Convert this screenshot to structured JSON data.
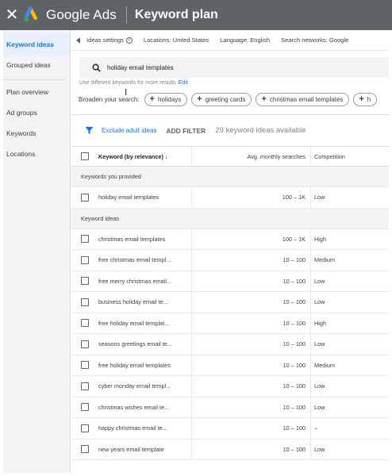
{
  "header": {
    "close_icon": "close-icon",
    "brand": "Google Ads",
    "title": "Keyword plan"
  },
  "sidebar": {
    "items": [
      {
        "label": "Keyword ideas",
        "active": true
      },
      {
        "label": "Grouped ideas"
      },
      {
        "label": "Plan overview"
      },
      {
        "label": "Ad groups"
      },
      {
        "label": "Keywords"
      },
      {
        "label": "Locations"
      }
    ]
  },
  "settings": {
    "ideas_settings": "Ideas settings",
    "locations": "Locations: United States",
    "language": "Language: English",
    "networks": "Search networks: Google"
  },
  "search": {
    "value": "holiday email templates",
    "hint": "Use different keywords for more results",
    "edit": "Edit"
  },
  "broaden": {
    "label": "Broaden your search:",
    "chips": [
      "holidays",
      "greeting cards",
      "christmas email templates",
      "h"
    ]
  },
  "filter": {
    "exclude": "Exclude adult ideas",
    "add_filter": "ADD FILTER",
    "available": "29 keyword ideas available"
  },
  "table": {
    "headers": {
      "keyword": "Keyword (by relevance)",
      "avg": "Avg. monthly searches",
      "competition": "Competition"
    },
    "group_provided": "Keywords you provided",
    "provided": [
      {
        "keyword": "holiday email templates",
        "avg": "100 – 1K",
        "competition": "Low"
      }
    ],
    "group_ideas": "Keyword ideas",
    "ideas": [
      {
        "keyword": "christmas email templates",
        "avg": "100 – 1K",
        "competition": "High"
      },
      {
        "keyword": "free christmas email templ...",
        "avg": "10 – 100",
        "competition": "Medium"
      },
      {
        "keyword": "free merry christmas email...",
        "avg": "10 – 100",
        "competition": "Low"
      },
      {
        "keyword": "business holiday email te...",
        "avg": "10 – 100",
        "competition": "Low"
      },
      {
        "keyword": "free holiday email templat...",
        "avg": "10 – 100",
        "competition": "High"
      },
      {
        "keyword": "seasons greetings email te...",
        "avg": "10 – 100",
        "competition": "Low"
      },
      {
        "keyword": "free holiday email templates",
        "avg": "10 – 100",
        "competition": "Medium"
      },
      {
        "keyword": "cyber monday email templ...",
        "avg": "10 – 100",
        "competition": "Low"
      },
      {
        "keyword": "christmas wishes email te...",
        "avg": "10 – 100",
        "competition": "Low"
      },
      {
        "keyword": "happy christmas email te...",
        "avg": "10 – 100",
        "competition": "–"
      },
      {
        "keyword": "new years email template",
        "avg": "10 – 100",
        "competition": "Low"
      }
    ]
  },
  "colors": {
    "header_bg": "#5f6368",
    "accent": "#1a73e8",
    "sidebar_bg": "#f1f3f4"
  }
}
